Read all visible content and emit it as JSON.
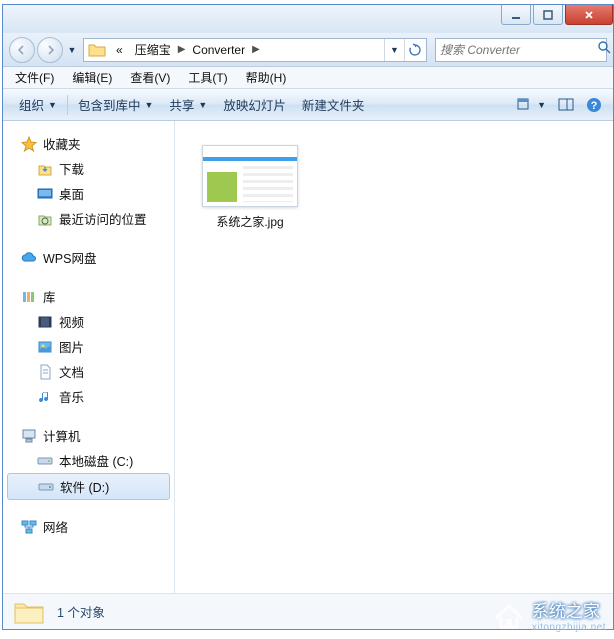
{
  "breadcrumb": {
    "prefix": "«",
    "part1": "压缩宝",
    "part2": "Converter"
  },
  "search": {
    "placeholder": "搜索 Converter"
  },
  "menu": {
    "file": "文件(F)",
    "edit": "编辑(E)",
    "view": "查看(V)",
    "tools": "工具(T)",
    "help": "帮助(H)"
  },
  "toolbar": {
    "organize": "组织",
    "include": "包含到库中",
    "share": "共享",
    "slideshow": "放映幻灯片",
    "newfolder": "新建文件夹"
  },
  "sidebar": {
    "favorites": {
      "label": "收藏夹",
      "items": [
        "下载",
        "桌面",
        "最近访问的位置"
      ]
    },
    "wps": {
      "label": "WPS网盘"
    },
    "libraries": {
      "label": "库",
      "items": [
        "视频",
        "图片",
        "文档",
        "音乐"
      ]
    },
    "computer": {
      "label": "计算机",
      "items": [
        "本地磁盘 (C:)",
        "软件 (D:)"
      ]
    },
    "network": {
      "label": "网络"
    }
  },
  "files": [
    {
      "name": "系统之家.jpg"
    }
  ],
  "status": {
    "text": "1 个对象"
  },
  "watermark": {
    "text": "系统之家",
    "sub": "xitongzhijia.net"
  }
}
